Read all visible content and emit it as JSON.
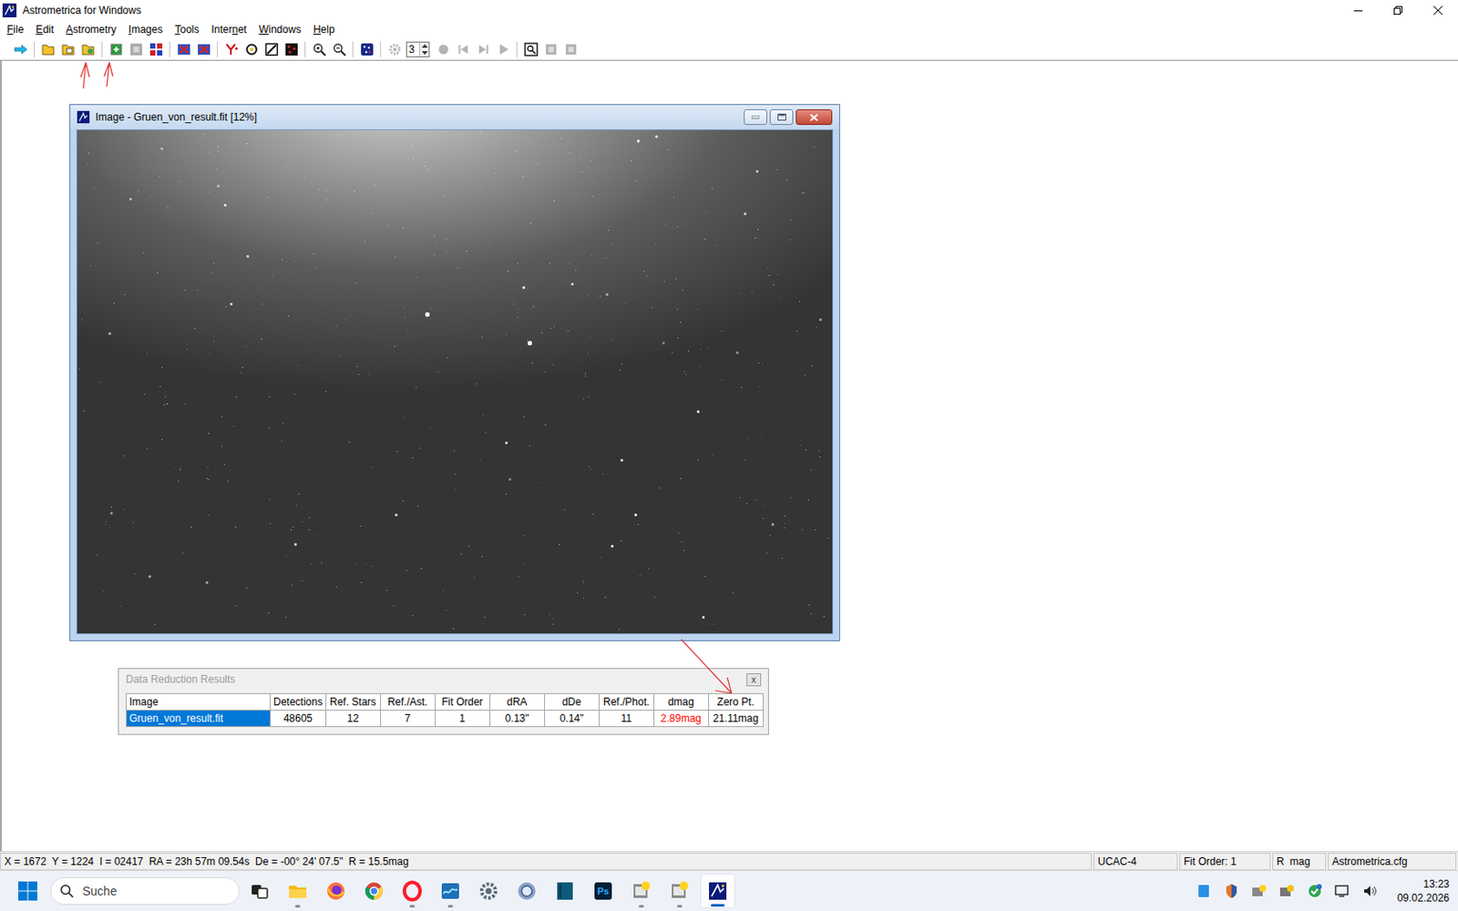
{
  "window": {
    "title": "Astrometrica for Windows"
  },
  "menu": [
    {
      "label": "File",
      "underline": 0
    },
    {
      "label": "Edit",
      "underline": 0
    },
    {
      "label": "Astrometry",
      "underline": 0
    },
    {
      "label": "Images",
      "underline": 0
    },
    {
      "label": "Tools",
      "underline": 0
    },
    {
      "label": "Internet",
      "underline": 5
    },
    {
      "label": "Windows",
      "underline": 0
    },
    {
      "label": "Help",
      "underline": 0
    }
  ],
  "toolbar": {
    "buttons": [
      {
        "disabled": false
      },
      {
        "disabled": false
      },
      {
        "disabled": false
      },
      {
        "disabled": false
      },
      {
        "disabled": false
      },
      {
        "disabled": true
      },
      {
        "disabled": false
      },
      {
        "disabled": false
      },
      {
        "disabled": false
      },
      {
        "disabled": false
      },
      {
        "disabled": false
      },
      {
        "disabled": false
      },
      {
        "disabled": false
      },
      {
        "disabled": false
      },
      {
        "disabled": false
      },
      {
        "disabled": false
      },
      {
        "disabled": true
      },
      {
        "disabled": true
      },
      {
        "disabled": true
      },
      {
        "disabled": true
      },
      {
        "disabled": true
      },
      {
        "disabled": false
      },
      {
        "disabled": true
      },
      {
        "disabled": true
      }
    ],
    "spinner": "3"
  },
  "image_window": {
    "title": "Image - Gruen_von_result.fit [12%]",
    "active": true
  },
  "results_window": {
    "title": "Data Reduction Results",
    "active": false,
    "close": "x",
    "columns": [
      "Image",
      "Detections",
      "Ref. Stars",
      "Ref./Ast.",
      "Fit Order",
      "dRA",
      "dDe",
      "Ref./Phot.",
      "dmag",
      "Zero Pt."
    ],
    "rows": [
      {
        "selected": true,
        "cells": [
          "Gruen_von_result.fit",
          "48605",
          "12",
          "7",
          "1",
          "0.13\"",
          "0.14\"",
          "11",
          "2.89mag",
          "21.11mag"
        ],
        "warning": [
          false,
          false,
          false,
          false,
          false,
          false,
          false,
          false,
          true,
          false
        ]
      }
    ]
  },
  "status_bar": {
    "position": "X = 1672  Y = 1224  I = 02417  RA = 23h 57m 09.54s  De = -00° 24' 07.5\"  R = 15.5mag",
    "panes": [
      "UCAC-4",
      "Fit Order: 1",
      "R  mag",
      "Astrometrica.cfg"
    ]
  },
  "taskbar": {
    "search": {
      "placeholder": "Suche"
    },
    "apps": [
      {
        "running": false,
        "selected": false
      },
      {
        "running": true,
        "selected": false
      },
      {
        "running": false,
        "selected": false
      },
      {
        "running": false,
        "selected": false
      },
      {
        "running": true,
        "selected": false
      },
      {
        "running": true,
        "selected": false
      },
      {
        "running": false,
        "selected": false
      },
      {
        "running": false,
        "selected": false
      },
      {
        "running": false,
        "selected": false
      },
      {
        "running": false,
        "selected": false,
        "badge": "Ps"
      },
      {
        "running": true,
        "selected": false
      },
      {
        "running": true,
        "selected": false
      },
      {
        "running": true,
        "selected": true
      }
    ],
    "clock": {
      "time": "13:23",
      "date": "09.02.2026"
    }
  }
}
